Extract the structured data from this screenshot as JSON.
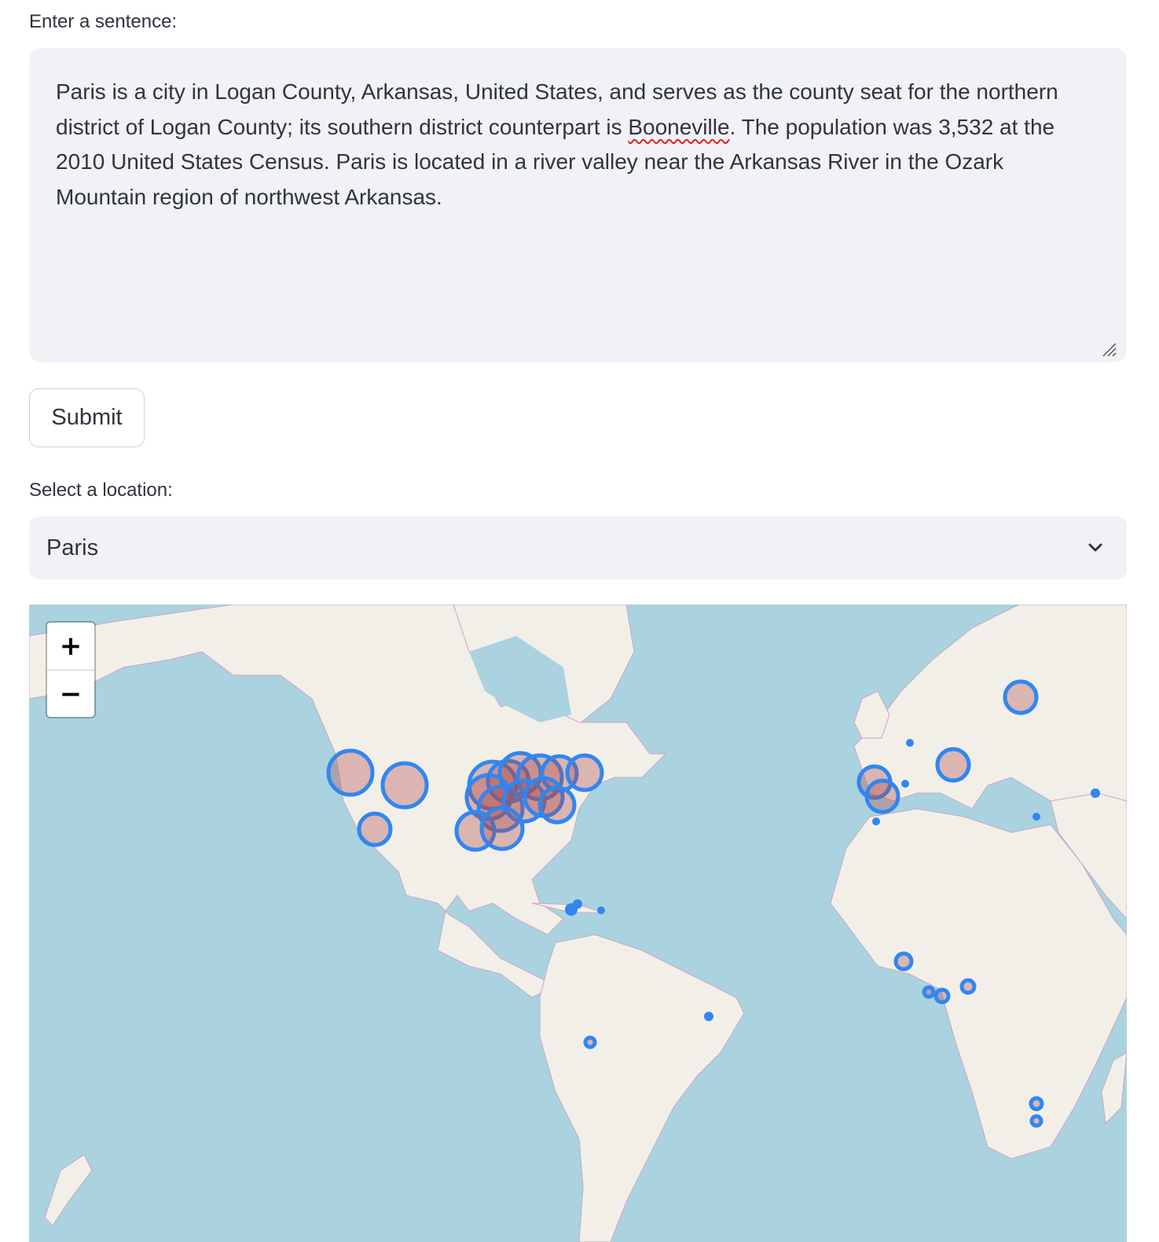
{
  "form": {
    "sentence_label": "Enter a sentence:",
    "sentence_value_before": "Paris is a city in Logan County, Arkansas, United States, and serves as the county seat for the northern district of Logan County; its southern district counterpart is ",
    "sentence_value_misspelled": "Booneville",
    "sentence_value_after": ". The population was 3,532 at the 2010 United States Census. Paris is located in a river valley near the Arkansas River in the Ozark Mountain region of northwest Arkansas.",
    "submit_label": "Submit",
    "select_label": "Select a location:",
    "select_value": "Paris"
  },
  "map": {
    "zoom_in_label": "+",
    "zoom_out_label": "−",
    "marker_stroke_color": "#3186f0",
    "marker_fill_color": "#b04a4a",
    "land_color": "#f2efe9",
    "water_color": "#aad3df",
    "border_color": "#c9a6c4"
  }
}
